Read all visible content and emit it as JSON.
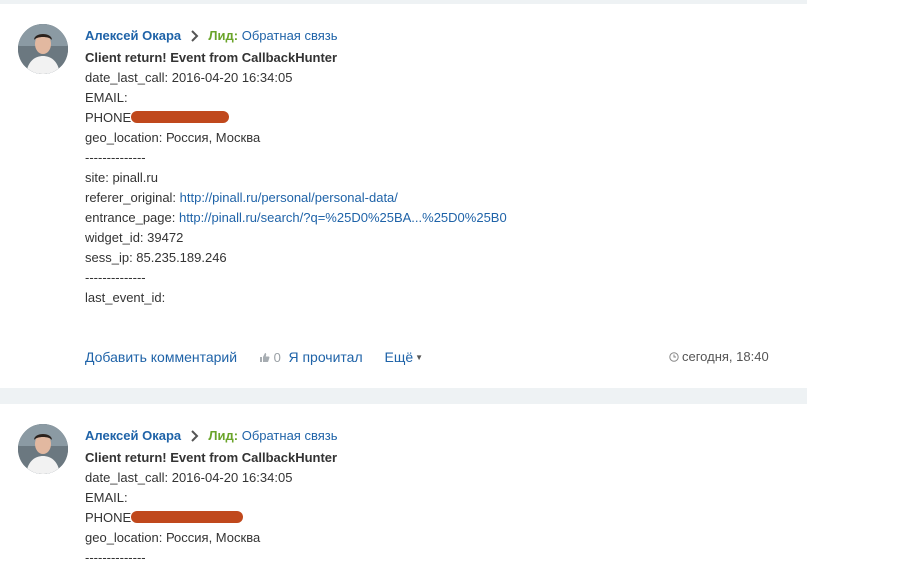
{
  "posts": [
    {
      "author": "Алексей Окара",
      "lead_label": "Лид:",
      "lead_target": "Обратная связь",
      "title": "Client return! Event from CallbackHunter",
      "date_last_call": "date_last_call: 2016-04-20 16:34:05",
      "email": "EMAIL:",
      "phone": "PHONE",
      "geo_location": "geo_location: Россия, Москва",
      "separator1": "--------------",
      "site": "site: pinall.ru",
      "referer_label": "referer_original: ",
      "referer_link": "http://pinall.ru/personal/personal-data/",
      "entrance_label": "entrance_page: ",
      "entrance_link": "http://pinall.ru/search/?q=%25D0%25BA...%25D0%25B0",
      "widget_id": "widget_id: 39472",
      "sess_ip": "sess_ip: 85.235.189.246",
      "separator2": "--------------",
      "last_event_id": "last_event_id:",
      "add_comment": "Добавить комментарий",
      "likes_count": "0",
      "read_label": "Я прочитал",
      "more_label": "Ещё",
      "timestamp": "сегодня, 18:40"
    },
    {
      "author": "Алексей Окара",
      "lead_label": "Лид:",
      "lead_target": "Обратная связь",
      "title": "Client return! Event from CallbackHunter",
      "date_last_call": "date_last_call: 2016-04-20 16:34:05",
      "email": "EMAIL:",
      "phone": "PHONE",
      "geo_location": "geo_location: Россия, Москва",
      "separator1": "--------------"
    }
  ],
  "colors": {
    "link": "#1f63a8",
    "lead_label": "#6aa42a",
    "redaction": "#c0481c",
    "separator_band": "#eef2f4"
  },
  "icons": [
    "chevron-right-icon",
    "thumbs-up-icon",
    "clock-icon",
    "caret-down-icon"
  ]
}
